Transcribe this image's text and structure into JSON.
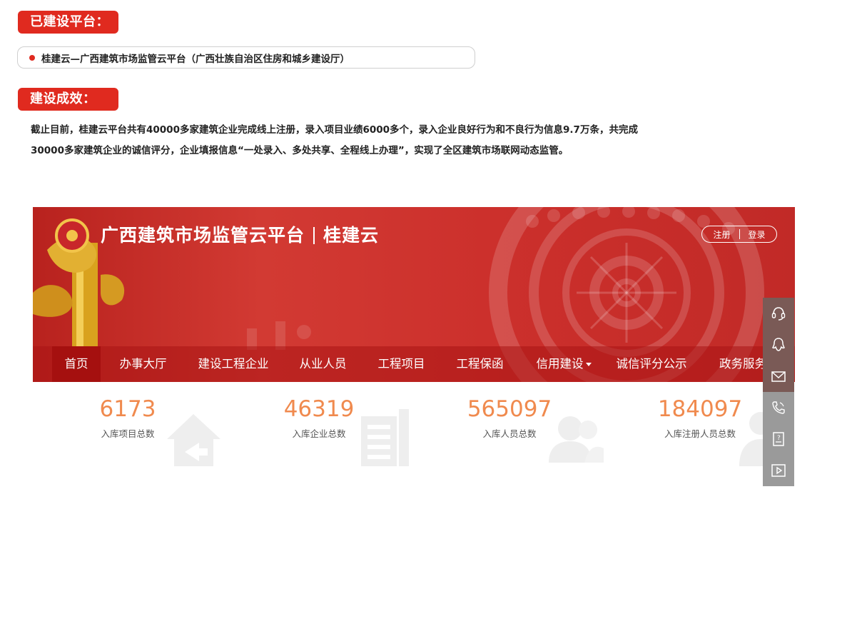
{
  "section_built": {
    "label": "已建设平台："
  },
  "platform": {
    "name": "桂建云—广西建筑市场监管云平台（广西壮族自治区住房和城乡建设厅）"
  },
  "section_effect": {
    "label": "建设成效："
  },
  "description": {
    "line1": "截止目前，桂建云平台共有40000多家建筑企业完成线上注册，录入项目业绩6000多个，录入企业良好行为和不良行为信息9.7万条，共完成",
    "line2": "30000多家建筑企业的诚信评分，企业填报信息“一处录入、多处共享、全程线上办理”，实现了全区建筑市场联网动态监管。"
  },
  "site": {
    "title_main": "广西建筑市场监管云平台",
    "title_brand": "桂建云",
    "register": "注册",
    "login": "登录",
    "nav": [
      {
        "label": "首页",
        "active": true
      },
      {
        "label": "办事大厅"
      },
      {
        "label": "建设工程企业"
      },
      {
        "label": "从业人员"
      },
      {
        "label": "工程项目"
      },
      {
        "label": "工程保函"
      },
      {
        "label": "信用建设",
        "dropdown": true
      },
      {
        "label": "诚信评分公示"
      },
      {
        "label": "政务服务"
      }
    ],
    "stats": [
      {
        "value": "6173",
        "label": "入库项目总数",
        "icon": "house-icon"
      },
      {
        "value": "46319",
        "label": "入库企业总数",
        "icon": "building-icon"
      },
      {
        "value": "565097",
        "label": "入库人员总数",
        "icon": "people-icon"
      },
      {
        "value": "184097",
        "label": "入库注册人员总数",
        "icon": "person-icon"
      }
    ],
    "side_tools": [
      "headset-icon",
      "chat-icon",
      "mail-icon",
      "phone-icon",
      "guide-icon",
      "video-icon"
    ]
  },
  "colors": {
    "accent": "#e02a1f",
    "banner": "#c8302c",
    "stat_number": "#f08a4e"
  }
}
